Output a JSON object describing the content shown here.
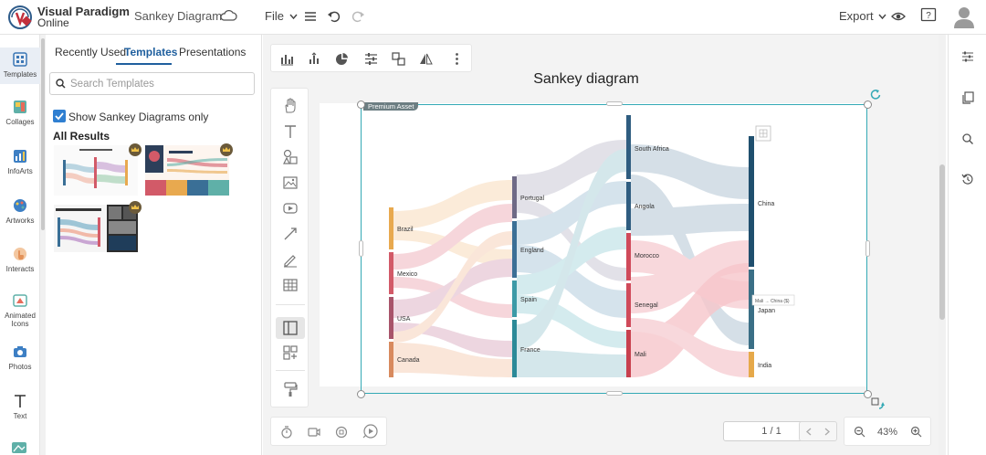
{
  "app": {
    "logo_line1": "Visual Paradigm",
    "logo_line2": "Online",
    "doc_title": "Sankey Diagram",
    "file_menu": "File",
    "export_menu": "Export"
  },
  "left_rail": {
    "items": [
      {
        "label": "Templates",
        "icon": "templates-icon"
      },
      {
        "label": "Collages",
        "icon": "collages-icon"
      },
      {
        "label": "InfoArts",
        "icon": "infoarts-icon"
      },
      {
        "label": "Artworks",
        "icon": "artworks-icon"
      },
      {
        "label": "Interacts",
        "icon": "interacts-icon"
      },
      {
        "label": "Animated Icons",
        "icon": "animated-icons-icon"
      },
      {
        "label": "Photos",
        "icon": "photos-icon"
      },
      {
        "label": "Text",
        "icon": "text-icon"
      }
    ]
  },
  "template_panel": {
    "tabs": [
      "Recently Used",
      "Templates",
      "Presentations"
    ],
    "active_tab": "Templates",
    "search_placeholder": "Search Templates",
    "checkbox_label": "Show Sankey Diagrams only",
    "section_title": "All Results"
  },
  "canvas": {
    "diagram_title": "Sankey diagram",
    "premium_label": "Premium Asset",
    "tooltip": "Mali → China ($)",
    "page_indicator": "1 / 1",
    "zoom": "43%"
  },
  "sankey": {
    "columns": [
      [
        "Brazil",
        "Mexico",
        "USA",
        "Canada"
      ],
      [
        "Portugal",
        "England",
        "Spain",
        "France"
      ],
      [
        "South Africa",
        "Angola",
        "Morocco",
        "Senegal",
        "Mali"
      ],
      [
        "China",
        "Japan",
        "India"
      ]
    ],
    "colors": {
      "Brazil": "#e8a94f",
      "Mexico": "#d25a68",
      "USA": "#a8546a",
      "Canada": "#d88a5e",
      "Portugal": "#6f6a86",
      "England": "#3c6f96",
      "Spain": "#3c9aa7",
      "France": "#2c8a98",
      "South Africa": "#2f5d80",
      "Angola": "#2f5d80",
      "Morocco": "#d04a5a",
      "Senegal": "#d04a5a",
      "Mali": "#c8404e",
      "China": "#1f4f6e",
      "Japan": "#3a6f86",
      "India": "#e6a94a"
    }
  },
  "accent": "#34a9b5"
}
